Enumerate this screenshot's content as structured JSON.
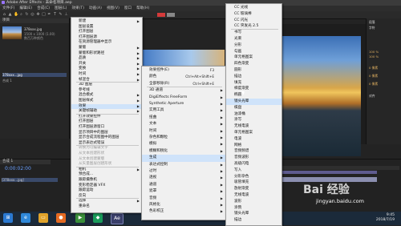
{
  "window": {
    "title": "Adobe After Effects - 未命名项目.aep"
  },
  "menubar": [
    "文件(F)",
    "编辑(E)",
    "合成(C)",
    "图层(L)",
    "效果(T)",
    "动画(A)",
    "视图(V)",
    "窗口",
    "帮助(H)"
  ],
  "project": {
    "tab": "项目",
    "file_name": "378xxx.jpg",
    "file_info": "1500 x 1000 (1.00)",
    "file_meta": "数百万种颜色",
    "items": [
      "378xxx...jpg",
      "合成 1"
    ]
  },
  "timeline": {
    "tab": "合成 1",
    "timecode": "0:00:02:00",
    "layer_name": "[378xxx...jpg]"
  },
  "menu1": {
    "items": [
      {
        "label": "新建",
        "arrow": true
      },
      {
        "label": "图层设置",
        "arrow": false
      },
      {
        "label": "打开图层",
        "arrow": false
      },
      {
        "label": "打开图层源",
        "arrow": false
      },
      {
        "label": "在资源管理器中显示",
        "arrow": false
      },
      {
        "label": "蒙版",
        "arrow": true
      },
      {
        "label": "蒙版和形状路径",
        "arrow": true
      },
      {
        "label": "品质",
        "arrow": true
      },
      {
        "label": "开关",
        "arrow": true
      },
      {
        "label": "变换",
        "arrow": true
      },
      {
        "label": "时间",
        "arrow": true
      },
      {
        "label": "帧混合",
        "arrow": true
      },
      {
        "label": "3D 图层",
        "arrow": false
      },
      {
        "label": "参考线",
        "arrow": false
      },
      {
        "label": "混合模式",
        "arrow": true
      },
      {
        "label": "图层样式",
        "arrow": true
      },
      {
        "label": "效果",
        "arrow": true,
        "highlight": true
      },
      {
        "label": "关键帧辅助",
        "arrow": true
      },
      {
        "label": "打开效果控件",
        "arrow": false
      },
      {
        "label": "打开图层",
        "arrow": false
      },
      {
        "label": "打开图层源窗口",
        "arrow": false
      },
      {
        "label": "显示项目中的图层",
        "arrow": false
      },
      {
        "label": "显示合成流程图中的图层",
        "arrow": false
      },
      {
        "label": "显示表达式错误",
        "arrow": false
      },
      {
        "label": "转换为可编辑文字",
        "arrow": false,
        "disabled": true
      },
      {
        "label": "从文本创建形状",
        "arrow": false,
        "disabled": true
      },
      {
        "label": "从文本创建蒙版",
        "arrow": false,
        "disabled": true
      },
      {
        "label": "从矢量图层创建形状",
        "arrow": false,
        "disabled": true
      },
      {
        "label": "相机",
        "arrow": true
      },
      {
        "label": "预合成...",
        "arrow": false
      },
      {
        "label": "跟踪摄像机",
        "arrow": false
      },
      {
        "label": "变形稳定器 VFX",
        "arrow": false
      },
      {
        "label": "跟踪运动",
        "arrow": false
      },
      {
        "label": "反向",
        "arrow": false
      },
      {
        "label": "选择",
        "arrow": true
      },
      {
        "label": "重命名",
        "arrow": false
      }
    ]
  },
  "menu2": {
    "items": [
      {
        "label": "效果控件(E)",
        "shortcut": "F3",
        "arrow": false
      },
      {
        "label": "颜色",
        "shortcut": "Ctrl+Alt+Shift+E",
        "arrow": false
      },
      {
        "label": "全部移除(R)",
        "shortcut": "Ctrl+Shift+E",
        "arrow": false
      },
      {
        "label": "3D 通道",
        "arrow": true
      },
      {
        "label": "DigiEffects FreeForm",
        "arrow": true
      },
      {
        "label": "Synthetic Aperture",
        "arrow": true
      },
      {
        "label": "实用工具",
        "arrow": true
      },
      {
        "label": "扭曲",
        "arrow": true
      },
      {
        "label": "文本",
        "arrow": true
      },
      {
        "label": "时间",
        "arrow": true
      },
      {
        "label": "杂色和颗粒",
        "arrow": true
      },
      {
        "label": "模拟",
        "arrow": true
      },
      {
        "label": "模糊和锐化",
        "arrow": true
      },
      {
        "label": "生成",
        "arrow": true,
        "highlight": true
      },
      {
        "label": "表达式控制",
        "arrow": true
      },
      {
        "label": "过时",
        "arrow": true
      },
      {
        "label": "透视",
        "arrow": true
      },
      {
        "label": "通道",
        "arrow": true
      },
      {
        "label": "遮罩",
        "arrow": true
      },
      {
        "label": "音频",
        "arrow": true
      },
      {
        "label": "风格化",
        "arrow": true
      },
      {
        "label": "色彩校正",
        "arrow": true
      }
    ]
  },
  "menu3": {
    "items": [
      {
        "label": "CC 光线"
      },
      {
        "label": "CC 玻璃棒"
      },
      {
        "label": "CC 闪光"
      },
      {
        "label": "CC 突发光 2.5"
      },
      {
        "label": "书写"
      },
      {
        "label": "光束"
      },
      {
        "label": "分形"
      },
      {
        "label": "勾画"
      },
      {
        "label": "单元格图案"
      },
      {
        "label": "四色渐变"
      },
      {
        "label": "圆形"
      },
      {
        "label": "描边"
      },
      {
        "label": "填充"
      },
      {
        "label": "梯度渐变"
      },
      {
        "label": "椭圆"
      },
      {
        "label": "镜头光晕",
        "highlight": true
      },
      {
        "label": "棋盘"
      },
      {
        "label": "油漆桶"
      },
      {
        "label": "涂写"
      },
      {
        "label": "无线电波"
      },
      {
        "label": "单元格图案"
      },
      {
        "label": "电波"
      },
      {
        "label": "网格"
      },
      {
        "label": "音频频谱"
      },
      {
        "label": "音频波形"
      },
      {
        "label": "高级闪电"
      },
      {
        "label": "写入"
      },
      {
        "label": "分形杂色"
      },
      {
        "label": "吸管填充"
      },
      {
        "label": "放射渐变"
      },
      {
        "label": "无线电波"
      },
      {
        "label": "波形"
      },
      {
        "label": "涂鸦"
      },
      {
        "label": "镜头光晕"
      },
      {
        "label": "描边"
      }
    ]
  },
  "right_panel": {
    "lines": [
      "段落",
      "字符",
      "100 %",
      "100 %",
      "0 像素",
      "0 像素",
      "0 像素",
      "对齐"
    ]
  },
  "taskbar": {
    "clock_time": "9:45",
    "clock_date": "2018/7/19"
  },
  "watermark": {
    "brand": "Bai 经验",
    "url": "jingyan.baidu.com"
  }
}
